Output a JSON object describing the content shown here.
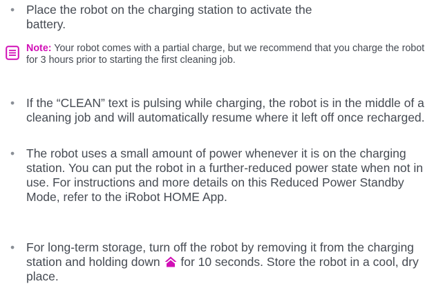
{
  "colors": {
    "accent": "#d10fb6",
    "text": "#454a52"
  },
  "bullets": [
    {
      "text": "Place the robot on the charging station to activate the battery."
    },
    {
      "text": "If the “CLEAN” text is pulsing while charging, the robot is in the middle of a cleaning job and will automatically resume where it left off once recharged."
    },
    {
      "text": "The robot uses a small amount of power whenever it is on the charging station. You can put the robot in a further-reduced power state when not in use. For instructions and more details on this Reduced Power Standby Mode, refer to the iRobot HOME App."
    },
    {
      "text_before": "For long-term storage, turn off the robot by removing it from the charging station and holding down",
      "icon": "home-icon",
      "text_after": "for 10 seconds. Store the robot in a cool, dry place."
    }
  ],
  "note": {
    "icon": "note-icon",
    "label": "Note:",
    "text": "Your robot comes with a partial charge, but we recommend that you charge the robot for 3 hours prior to starting the first cleaning job."
  }
}
